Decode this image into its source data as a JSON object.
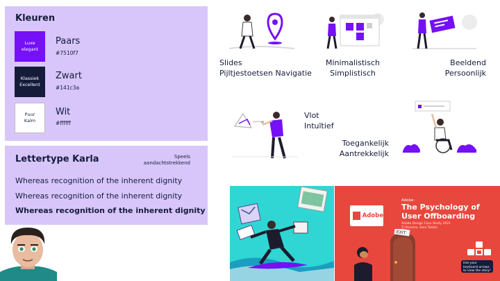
{
  "colors_panel": {
    "title": "Kleuren",
    "swatches": [
      {
        "word1": "Luxe",
        "word2": "elegant",
        "name": "Paars",
        "hex": "#7510f7"
      },
      {
        "word1": "Klassiek",
        "word2": "Excellent",
        "name": "Zwart",
        "hex": "#141c3a"
      },
      {
        "word1": "Puur",
        "word2": "Kalm",
        "name": "Wit",
        "hex": "#ffffff"
      }
    ]
  },
  "font_panel": {
    "title": "Lettertype Karla",
    "tag1": "Speels",
    "tag2": "aandachtstrekkend",
    "samples": [
      "Whereas recognition of the inherent dignity",
      "Whereas recognition of the inherent dignity",
      "Whereas recognition of the inherent dignity"
    ]
  },
  "principles": {
    "slides": {
      "line1": "Slides",
      "line2": "Pijltjestoetsen Navigatie"
    },
    "minimal": {
      "line1": "Minimalistisch",
      "line2": "Simplistisch"
    },
    "visual": {
      "line1": "Beeldend",
      "line2": "Persoonlijk"
    },
    "smooth": {
      "line1": "Vlot",
      "line2": "Intuïtief"
    },
    "access": {
      "line1": "Toegankelijk",
      "line2": "Aantrekkelijk"
    }
  },
  "banner_right": {
    "logo_text": "Adobe",
    "tag": "Adobe:",
    "title": "The Psychology of User Offboarding",
    "subtitle_line1": "Adobe Design Case Study 2021",
    "subtitle_line2": "Ti Stevens, Sara Toekin",
    "exit_sign": "EXIT",
    "hint": "Use your keyboard arrows to view the story!"
  },
  "theme": {
    "purple": "#7510f7",
    "lavender": "#d8c6fb",
    "navy": "#141c3a",
    "coral": "#e8473d",
    "teal": "#2fd6d4"
  }
}
